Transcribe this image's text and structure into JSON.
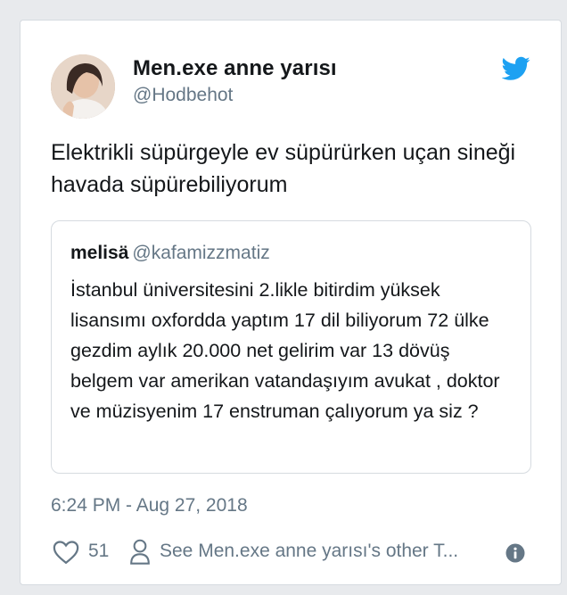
{
  "tweet": {
    "author": {
      "display_name": "Men.exe anne yarısı",
      "handle": "@Hodbehot",
      "avatar_icon": "profile-photo"
    },
    "text": "Elektrikli süpürgeyle ev süpürürken uçan sineği havada süpürebiliyorum",
    "quoted_tweet": {
      "name": "melisä",
      "handle": "@kafamizzmatiz",
      "text": "İstanbul üniversitesini 2.likle bitirdim yüksek lisansımı oxfordda yaptım 17 dil biliyorum 72 ülke gezdim aylık 20.000 net gelirim var 13 dövüş belgem var amerikan vatandaşıyım avukat , doktor ve müzisyenim 17 enstruman çalıyorum ya siz ?"
    },
    "timestamp": "6:24 PM - Aug 27, 2018",
    "likes": "51",
    "other_tweets_link": "See Men.exe anne yarısı's other T...",
    "icons": {
      "brand": "twitter-bird-icon",
      "like": "heart-icon",
      "profile": "person-icon",
      "info": "info-icon"
    }
  },
  "colors": {
    "twitter_blue": "#1da1f2",
    "text_primary": "#14171a",
    "text_secondary": "#657786",
    "border": "#d6dbe0",
    "background": "#e8eaed"
  }
}
